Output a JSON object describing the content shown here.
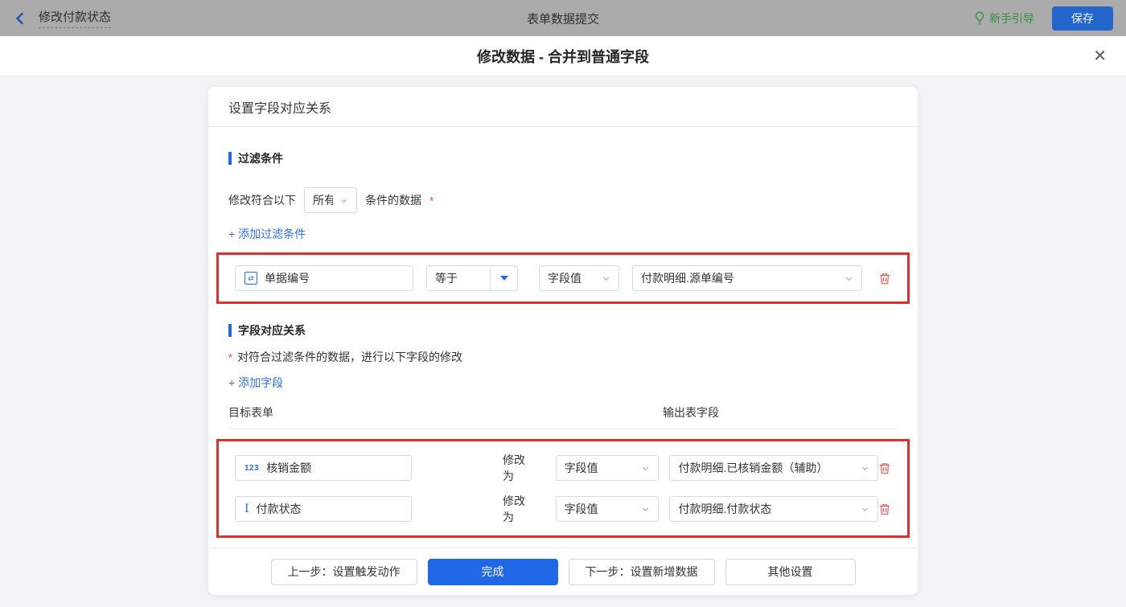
{
  "topbar": {
    "back_title": "修改付款状态",
    "center_title": "表单数据提交",
    "guide_label": "新手引导",
    "save_label": "保存"
  },
  "dialog": {
    "title": "修改数据 - 合并到普通字段",
    "close_glyph": "✕"
  },
  "panel": {
    "header_title": "设置字段对应关系",
    "filter": {
      "section_title": "过滤条件",
      "match_prefix": "修改符合以下",
      "match_value": "所有",
      "match_suffix": "条件的数据",
      "required_mark": "*",
      "add_link": "+ 添加过滤条件",
      "row": {
        "field_icon_glyph": "⇄",
        "field_icon_name": "serial-number-field",
        "field_label": "单据编号",
        "operator_label": "等于",
        "value_type_label": "字段值",
        "value_label": "付款明细.源单编号"
      }
    },
    "mapping": {
      "section_title": "字段对应关系",
      "required_mark": "*",
      "description": "对符合过滤条件的数据，进行以下字段的修改",
      "add_link": "+ 添加字段",
      "col_target": "目标表单",
      "col_output": "输出表字段",
      "rows": [
        {
          "icon_glyph": "123",
          "icon_name": "number-field",
          "field_label": "核销金额",
          "action_label": "修改为",
          "value_type_label": "字段值",
          "value_label": "付款明细.已核销金额（辅助）"
        },
        {
          "icon_glyph": "I",
          "icon_name": "text-field",
          "field_label": "付款状态",
          "action_label": "修改为",
          "value_type_label": "字段值",
          "value_label": "付款明细.付款状态"
        }
      ]
    },
    "footer": {
      "prev_label": "上一步：设置触发动作",
      "done_label": "完成",
      "next_label": "下一步：设置新增数据",
      "other_label": "其他设置"
    }
  },
  "colors": {
    "accent_blue": "#2168e8",
    "link_blue": "#2970eb",
    "highlight_red": "#e12f2c",
    "trash_red": "#f2544f",
    "guide_green": "#32913d",
    "save_blue": "#2365cb",
    "topbar_gray": "#ababab"
  }
}
